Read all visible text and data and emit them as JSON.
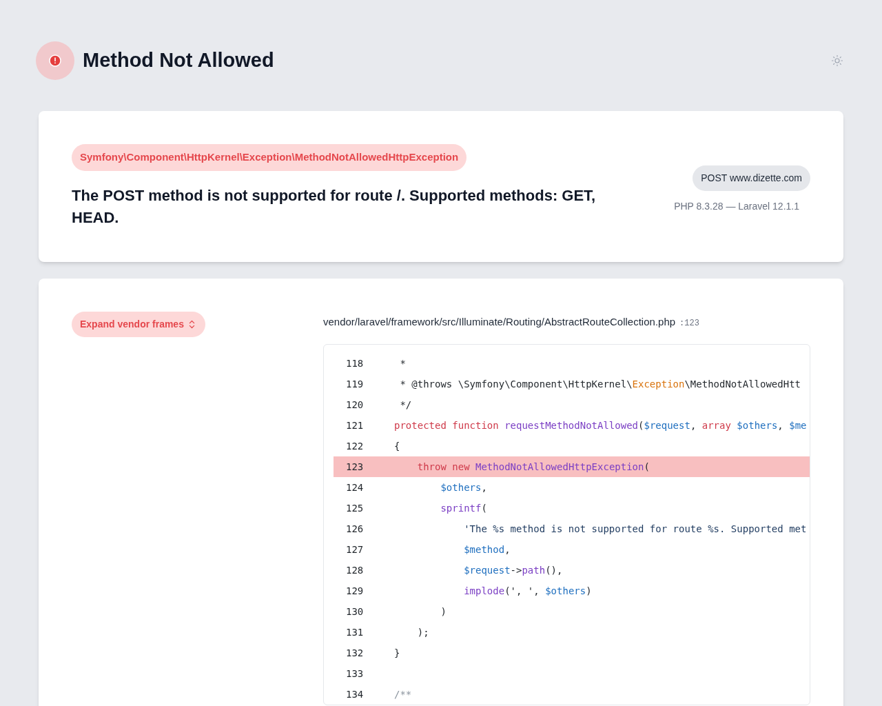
{
  "header": {
    "title": "Method Not Allowed"
  },
  "exception": {
    "class": "Symfony\\Component\\HttpKernel\\Exception\\MethodNotAllowedHttpException",
    "message": "The POST method is not supported for route /. Supported methods: GET, HEAD.",
    "request": "POST www.dizette.com",
    "versions": "PHP 8.3.28 — Laravel 12.1.1"
  },
  "frames": {
    "expand_button": "Expand vendor frames",
    "file": "vendor/laravel/framework/src/Illuminate/Routing/AbstractRouteCollection.php",
    "line": ":123",
    "code": [
      {
        "number": "118",
        "highlighted": false,
        "tokens": [
          {
            "kind": "plain",
            "text": " *"
          }
        ]
      },
      {
        "number": "119",
        "highlighted": false,
        "tokens": [
          {
            "kind": "plain",
            "text": " * @throws \\Symfony\\Component\\HttpKernel\\"
          },
          {
            "kind": "namespace",
            "text": "Exception"
          },
          {
            "kind": "plain",
            "text": "\\MethodNotAllowedHtt"
          }
        ]
      },
      {
        "number": "120",
        "highlighted": false,
        "tokens": [
          {
            "kind": "plain",
            "text": " */"
          }
        ]
      },
      {
        "number": "121",
        "highlighted": false,
        "tokens": [
          {
            "kind": "keyword",
            "text": "protected function "
          },
          {
            "kind": "name",
            "text": "requestMethodNotAllowed"
          },
          {
            "kind": "plain",
            "text": "("
          },
          {
            "kind": "variable",
            "text": "$request"
          },
          {
            "kind": "plain",
            "text": ", "
          },
          {
            "kind": "keyword",
            "text": "array "
          },
          {
            "kind": "variable",
            "text": "$others"
          },
          {
            "kind": "plain",
            "text": ", "
          },
          {
            "kind": "variable",
            "text": "$me"
          }
        ]
      },
      {
        "number": "122",
        "highlighted": false,
        "tokens": [
          {
            "kind": "plain",
            "text": "{"
          }
        ]
      },
      {
        "number": "123",
        "highlighted": true,
        "tokens": [
          {
            "kind": "keyword",
            "text": "    throw new "
          },
          {
            "kind": "name",
            "text": "MethodNotAllowedHttpException"
          },
          {
            "kind": "plain",
            "text": "("
          }
        ]
      },
      {
        "number": "124",
        "highlighted": false,
        "tokens": [
          {
            "kind": "variable",
            "text": "        $others"
          },
          {
            "kind": "plain",
            "text": ","
          }
        ]
      },
      {
        "number": "125",
        "highlighted": false,
        "tokens": [
          {
            "kind": "name",
            "text": "        sprintf"
          },
          {
            "kind": "plain",
            "text": "("
          }
        ]
      },
      {
        "number": "126",
        "highlighted": false,
        "tokens": [
          {
            "kind": "string",
            "text": "            'The %s method is not supported for route %s. Supported met"
          }
        ]
      },
      {
        "number": "127",
        "highlighted": false,
        "tokens": [
          {
            "kind": "variable",
            "text": "            $method"
          },
          {
            "kind": "plain",
            "text": ","
          }
        ]
      },
      {
        "number": "128",
        "highlighted": false,
        "tokens": [
          {
            "kind": "variable",
            "text": "            $request"
          },
          {
            "kind": "plain",
            "text": "->"
          },
          {
            "kind": "name",
            "text": "path"
          },
          {
            "kind": "plain",
            "text": "(),"
          }
        ]
      },
      {
        "number": "129",
        "highlighted": false,
        "tokens": [
          {
            "kind": "name",
            "text": "            implode"
          },
          {
            "kind": "plain",
            "text": "(', ', "
          },
          {
            "kind": "variable",
            "text": "$others"
          },
          {
            "kind": "plain",
            "text": ")"
          }
        ]
      },
      {
        "number": "130",
        "highlighted": false,
        "tokens": [
          {
            "kind": "plain",
            "text": "        )"
          }
        ]
      },
      {
        "number": "131",
        "highlighted": false,
        "tokens": [
          {
            "kind": "plain",
            "text": "    );"
          }
        ]
      },
      {
        "number": "132",
        "highlighted": false,
        "tokens": [
          {
            "kind": "plain",
            "text": "}"
          }
        ]
      },
      {
        "number": "133",
        "highlighted": false
      },
      {
        "number": "134",
        "highlighted": false,
        "tokens": [
          {
            "kind": "comment",
            "text": "/**"
          }
        ]
      }
    ]
  }
}
